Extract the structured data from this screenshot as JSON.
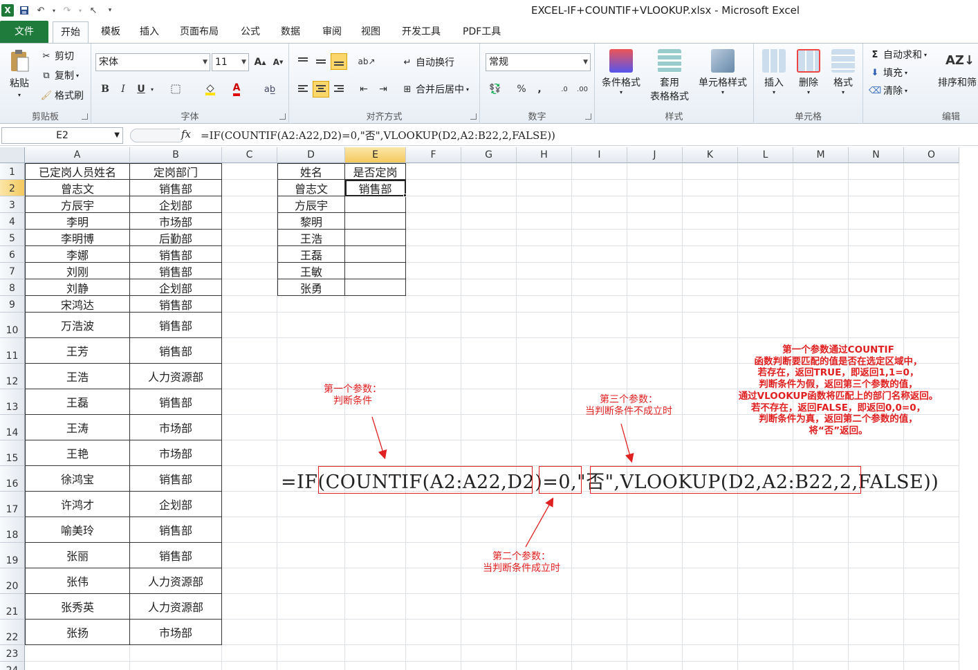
{
  "window": {
    "title": "EXCEL-IF+COUNTIF+VLOOKUP.xlsx - Microsoft Excel"
  },
  "qat": {
    "logo": "X"
  },
  "tabs": [
    "文件",
    "开始",
    "模板",
    "插入",
    "页面布局",
    "公式",
    "数据",
    "审阅",
    "视图",
    "开发工具",
    "PDF工具"
  ],
  "ribbon": {
    "clipboard": {
      "paste": "粘贴",
      "cut": "剪切",
      "copy": "复制",
      "format_painter": "格式刷",
      "label": "剪贴板"
    },
    "font": {
      "name": "宋体",
      "size": "11",
      "label": "字体",
      "bold": "B",
      "italic": "I",
      "underline": "U",
      "grow": "A",
      "shrink": "A",
      "color": "A"
    },
    "align": {
      "wrap": "自动换行",
      "merge": "合并后居中",
      "label": "对齐方式"
    },
    "number": {
      "format": "常规",
      "percent": "%",
      "comma": ",",
      "inc": ".0",
      "dec": ".00",
      "label": "数字"
    },
    "styles": {
      "cond": "条件格式",
      "table": "套用",
      "table2": "表格格式",
      "cell": "单元格样式",
      "label": "样式"
    },
    "cells": {
      "insert": "插入",
      "delete": "删除",
      "format": "格式",
      "label": "单元格"
    },
    "edit": {
      "autosum": "自动求和",
      "fill": "填充",
      "clear": "清除",
      "sort": "排序和筛",
      "label": "编辑"
    }
  },
  "formula_bar": {
    "name_box": "E2",
    "fx": "fx",
    "formula": "=IF(COUNTIF(A2:A22,D2)=0,\"否\",VLOOKUP(D2,A2:B22,2,FALSE))"
  },
  "columns": [
    "A",
    "B",
    "C",
    "D",
    "E",
    "F",
    "G",
    "H",
    "I",
    "J",
    "K",
    "L",
    "M",
    "N",
    "O"
  ],
  "rows": [
    "1",
    "2",
    "3",
    "4",
    "5",
    "6",
    "7",
    "8",
    "9",
    "10",
    "11",
    "12",
    "13",
    "14",
    "15",
    "16",
    "17",
    "18",
    "19",
    "20",
    "21",
    "22",
    "23",
    "24"
  ],
  "table1": {
    "header": [
      "已定岗人员姓名",
      "定岗部门"
    ],
    "rows": [
      [
        "曾志文",
        "销售部"
      ],
      [
        "方辰宇",
        "企划部"
      ],
      [
        "李明",
        "市场部"
      ],
      [
        "李明博",
        "后勤部"
      ],
      [
        "李娜",
        "销售部"
      ],
      [
        "刘刚",
        "销售部"
      ],
      [
        "刘静",
        "企划部"
      ],
      [
        "宋鸿达",
        "销售部"
      ],
      [
        "万浩波",
        "销售部"
      ],
      [
        "王芳",
        "销售部"
      ],
      [
        "王浩",
        "人力资源部"
      ],
      [
        "王磊",
        "销售部"
      ],
      [
        "王涛",
        "市场部"
      ],
      [
        "王艳",
        "市场部"
      ],
      [
        "徐鸿宝",
        "销售部"
      ],
      [
        "许鸿才",
        "企划部"
      ],
      [
        "喻美玲",
        "销售部"
      ],
      [
        "张丽",
        "销售部"
      ],
      [
        "张伟",
        "人力资源部"
      ],
      [
        "张秀英",
        "人力资源部"
      ],
      [
        "张扬",
        "市场部"
      ]
    ]
  },
  "table2": {
    "header": [
      "姓名",
      "是否定岗"
    ],
    "rows": [
      [
        "曾志文",
        "销售部"
      ],
      [
        "方辰宇",
        ""
      ],
      [
        "黎明",
        ""
      ],
      [
        "王浩",
        ""
      ],
      [
        "王磊",
        ""
      ],
      [
        "王敏",
        ""
      ],
      [
        "张勇",
        ""
      ]
    ]
  },
  "annotation": {
    "formula_parts": [
      "=IF(",
      "COUNTIF(A2:A22,D2)=0",
      ",",
      "\"否\"",
      ",",
      "VLOOKUP(D2,A2:B22,2,FALSE)",
      ")"
    ],
    "param1": [
      "第一个参数：",
      "判断条件"
    ],
    "param2": [
      "第二个参数：",
      "当判断条件成立时"
    ],
    "param3": [
      "第三个参数：",
      "当判断条件不成立时"
    ],
    "explain": [
      "第一个参数通过COUNTIF",
      "函数判断要匹配的值是否在选定区域中，",
      "若存在，返回TRUE，即返回1,1=0，",
      "判断条件为假，返回第三个参数的值，",
      "通过VLOOKUP函数将匹配上的部门名称返回。",
      "若不存在，返回FALSE，即返回0,0=0，",
      "判断条件为真，返回第二个参数的值，",
      "将“否”返回。"
    ]
  },
  "colors": {
    "accent": "#1e7b3b",
    "annotation": "#e02020",
    "selected_header": "#f4c95e"
  }
}
